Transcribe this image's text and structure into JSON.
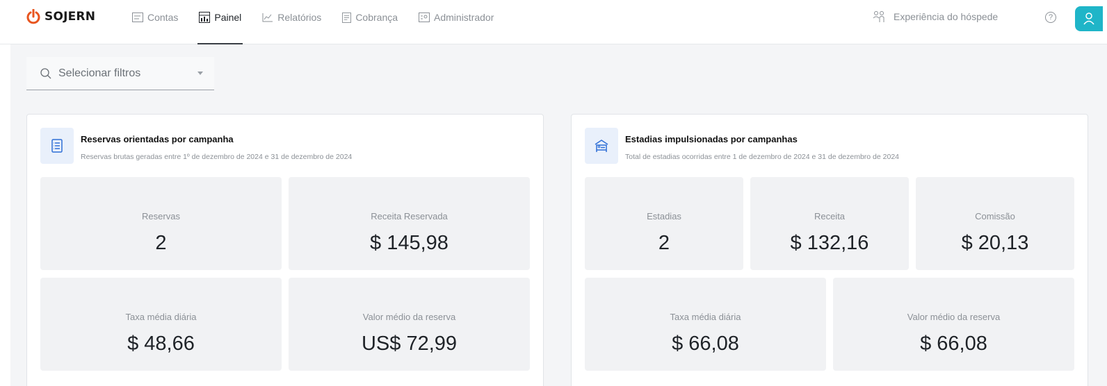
{
  "brand": {
    "name": "SOJERN",
    "accent": "#e8551f"
  },
  "nav": {
    "items": [
      {
        "label": "Contas",
        "icon": "accounts-icon",
        "active": false
      },
      {
        "label": "Painel",
        "icon": "dashboard-icon",
        "active": true
      },
      {
        "label": "Relatórios",
        "icon": "reports-icon",
        "active": false
      },
      {
        "label": "Cobrança",
        "icon": "billing-icon",
        "active": false
      },
      {
        "label": "Administrador",
        "icon": "admin-icon",
        "active": false
      }
    ],
    "guest_experience": "Experiência do hóspede",
    "help": "?"
  },
  "filter": {
    "placeholder": "Selecionar filtros"
  },
  "cards": {
    "left": {
      "title": "Reservas orientadas por campanha",
      "subtitle": "Reservas brutas geradas entre 1º de dezembro de 2024 e 31 de dezembro de 2024",
      "tiles": [
        {
          "label": "Reservas",
          "value": "2"
        },
        {
          "label": "Receita Reservada",
          "value": "$ 145,98"
        },
        {
          "label": "Taxa média diária",
          "value": "$ 48,66"
        },
        {
          "label": "Valor médio da reserva",
          "value": "US$ 72,99"
        }
      ]
    },
    "right": {
      "title": "Estadias impulsionadas por campanhas",
      "subtitle": "Total de estadias ocorridas entre 1 de dezembro de 2024 e 31 de dezembro de 2024",
      "tiles": [
        {
          "label": "Estadias",
          "value": "2"
        },
        {
          "label": "Receita",
          "value": "$ 132,16"
        },
        {
          "label": "Comissão",
          "value": "$ 20,13"
        },
        {
          "label": "Taxa média diária",
          "value": "$ 66,08"
        },
        {
          "label": "Valor médio da reserva",
          "value": "$ 66,08"
        }
      ]
    }
  },
  "colors": {
    "accent_teal": "#1fb5c8",
    "icon_blue": "#2f6fd6",
    "icon_bg": "#e9f0fb"
  }
}
